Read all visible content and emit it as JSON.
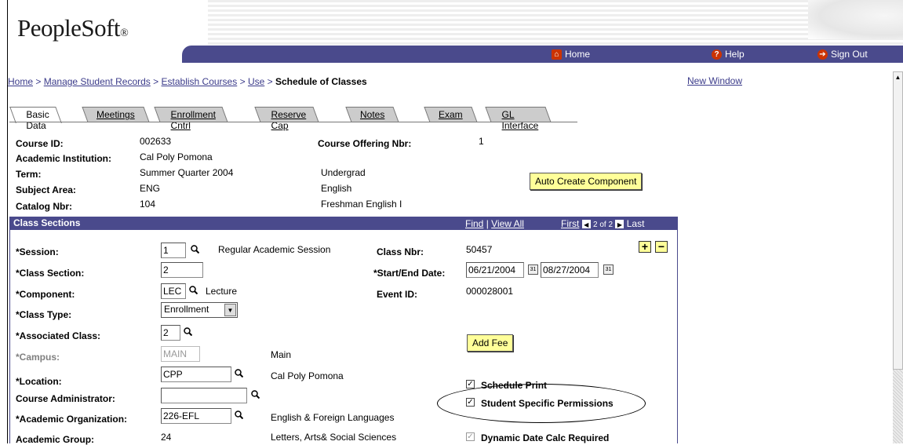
{
  "header": {
    "logo": "PeopleSoft",
    "logo_suffix": "®",
    "nav": {
      "home": "Home",
      "help": "Help",
      "signout": "Sign Out"
    },
    "band_color": "#4a4a8c"
  },
  "breadcrumb": {
    "items": [
      "Home",
      "Manage Student Records",
      "Establish Courses",
      "Use"
    ],
    "current": "Schedule of Classes",
    "separator": ">"
  },
  "new_window": "New Window",
  "tabs": [
    "Basic Data",
    "Meetings",
    "Enrollment Cntrl",
    "Reserve Cap",
    "Notes",
    "Exam",
    "GL Interface"
  ],
  "course": {
    "course_id_label": "Course ID:",
    "course_id": "002633",
    "institution_label": "Academic Institution:",
    "institution": "Cal Poly Pomona",
    "term_label": "Term:",
    "term": "Summer Quarter 2004",
    "career": "Undergrad",
    "subject_label": "Subject Area:",
    "subject": "ENG",
    "subject_desc": "English",
    "catalog_label": "Catalog Nbr:",
    "catalog": "104",
    "catalog_desc": "Freshman English I",
    "offering_label": "Course Offering Nbr:",
    "offering": "1",
    "auto_create": "Auto Create Component"
  },
  "section": {
    "title": "Class Sections",
    "find": "Find",
    "view_all": "View All",
    "first": "First",
    "page": "2 of 2",
    "last": "Last",
    "session_label": "*Session:",
    "session": "1",
    "session_desc": "Regular Academic Session",
    "class_nbr_label": "Class Nbr:",
    "class_nbr": "50457",
    "class_section_label": "*Class Section:",
    "class_section": "2",
    "start_end_label": "*Start/End Date:",
    "start_date": "06/21/2004",
    "end_date": "08/27/2004",
    "component_label": "*Component:",
    "component": "LEC",
    "component_desc": "Lecture",
    "event_id_label": "Event ID:",
    "event_id": "000028001",
    "class_type_label": "*Class Type:",
    "class_type": "Enrollment",
    "assoc_label": "*Associated Class:",
    "assoc": "2",
    "add_fee": "Add Fee",
    "campus_label": "*Campus:",
    "campus": "MAIN",
    "campus_desc": "Main",
    "location_label": "*Location:",
    "location": "CPP",
    "location_desc": "Cal Poly Pomona",
    "course_admin_label": "Course Administrator:",
    "course_admin": "",
    "acad_org_label": "*Academic Organization:",
    "acad_org": "226-EFL",
    "acad_org_desc": "English & Foreign Languages",
    "acad_group_label": "Academic Group:",
    "acad_group": "24",
    "acad_group_desc": "Letters, Arts& Social Sciences",
    "schedule_print": "Schedule Print",
    "student_perm": "Student Specific Permissions",
    "dynamic_date": "Dynamic Date Calc Required",
    "plus": "+",
    "minus": "−"
  }
}
